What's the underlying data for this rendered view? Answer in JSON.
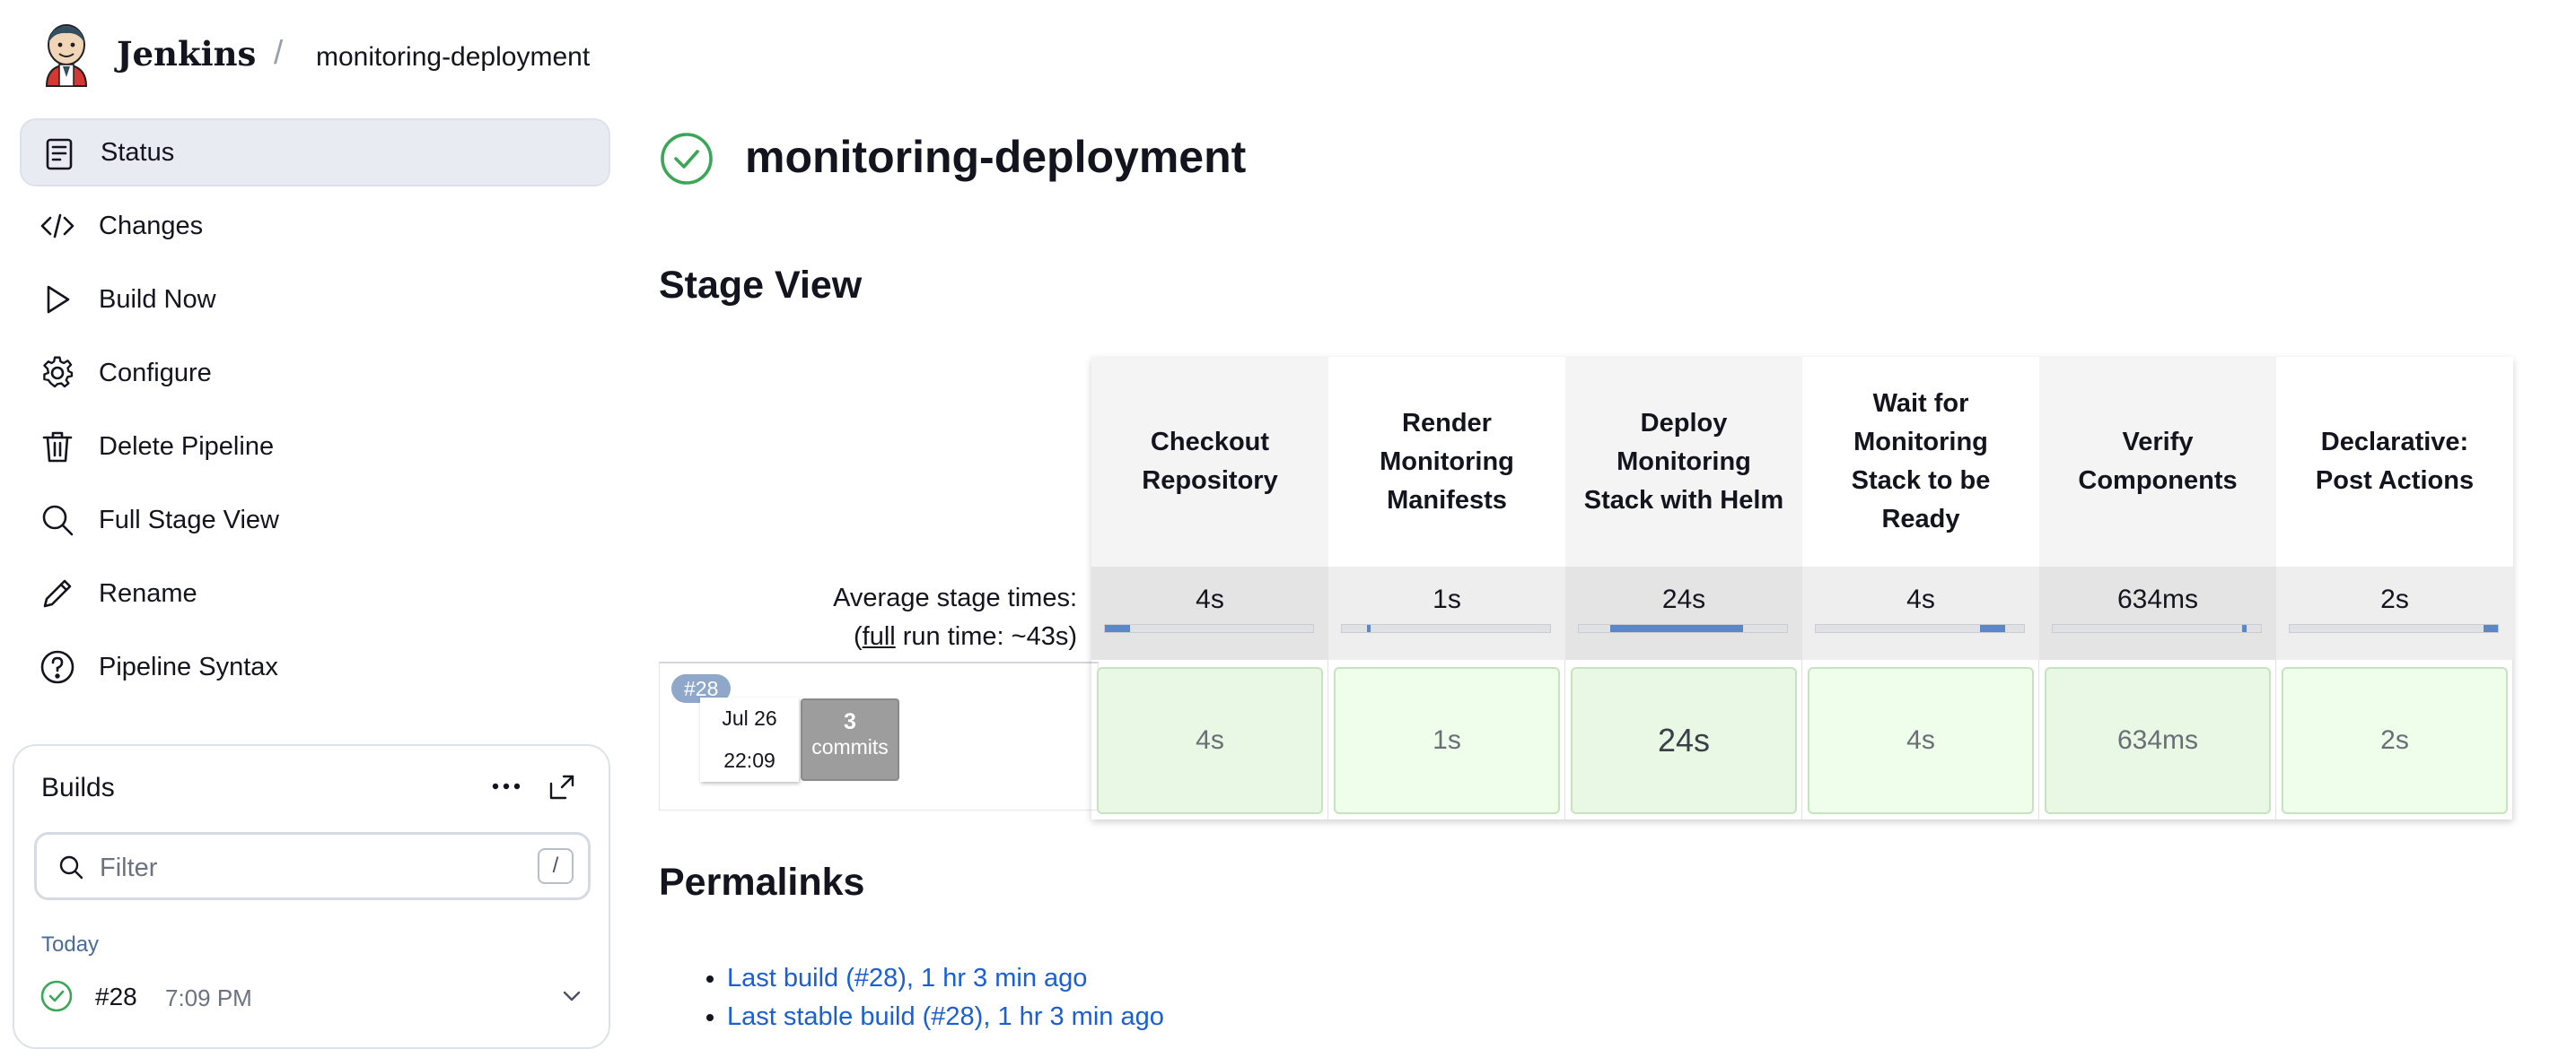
{
  "header": {
    "brand": "Jenkins",
    "separator": "/",
    "breadcrumb_job": "monitoring-deployment"
  },
  "sidebar": {
    "items": [
      {
        "label": "Status",
        "icon": "document-icon",
        "active": true
      },
      {
        "label": "Changes",
        "icon": "code-icon"
      },
      {
        "label": "Build Now",
        "icon": "play-icon"
      },
      {
        "label": "Configure",
        "icon": "gear-icon"
      },
      {
        "label": "Delete Pipeline",
        "icon": "trash-icon"
      },
      {
        "label": "Full Stage View",
        "icon": "search-icon"
      },
      {
        "label": "Rename",
        "icon": "pencil-icon"
      },
      {
        "label": "Pipeline Syntax",
        "icon": "help-icon"
      }
    ]
  },
  "builds": {
    "title": "Builds",
    "filter_placeholder": "Filter",
    "filter_shortcut": "/",
    "group_label": "Today",
    "items": [
      {
        "number": "#28",
        "time": "7:09 PM",
        "status": "success"
      }
    ]
  },
  "main": {
    "title": "monitoring-deployment",
    "stage_view_heading": "Stage View",
    "permalinks_heading": "Permalinks"
  },
  "stage_view": {
    "avg_label_line1": "Average stage times:",
    "avg_label_open": "(",
    "avg_label_full": "full",
    "avg_label_rest": " run time: ~43s)",
    "stages": [
      {
        "name": "Checkout Repository",
        "avg": "4s",
        "bar_start": 0.0,
        "bar_fraction": 0.12,
        "run_value": "4s"
      },
      {
        "name": "Render Monitoring Manifests",
        "avg": "1s",
        "bar_start": 0.12,
        "bar_fraction": 0.02,
        "run_value": "1s"
      },
      {
        "name": "Deploy Monitoring Stack with Helm",
        "avg": "24s",
        "bar_start": 0.15,
        "bar_fraction": 0.64,
        "run_value": "24s"
      },
      {
        "name": "Wait for Monitoring Stack to be Ready",
        "avg": "4s",
        "bar_start": 0.79,
        "bar_fraction": 0.12,
        "run_value": "4s"
      },
      {
        "name": "Verify Components",
        "avg": "634ms",
        "bar_start": 0.91,
        "bar_fraction": 0.02,
        "run_value": "634ms"
      },
      {
        "name": "Declarative: Post Actions",
        "avg": "2s",
        "bar_start": 0.93,
        "bar_fraction": 0.07,
        "run_value": "2s"
      }
    ],
    "run": {
      "badge": "#28",
      "date": "Jul 26",
      "time": "22:09",
      "commit_count": "3",
      "commit_label": "commits"
    }
  },
  "permalinks": [
    "Last build (#28), 1 hr 3 min ago",
    "Last stable build (#28), 1 hr 3 min ago"
  ],
  "colors": {
    "success_green": "#3aa756",
    "link_blue": "#1a5fd3",
    "bar_blue": "#5b86c8",
    "cell_fill_light": "#effdeb",
    "cell_fill_dark": "#e9f7e5",
    "sidebar_active": "#e8ecf2"
  }
}
